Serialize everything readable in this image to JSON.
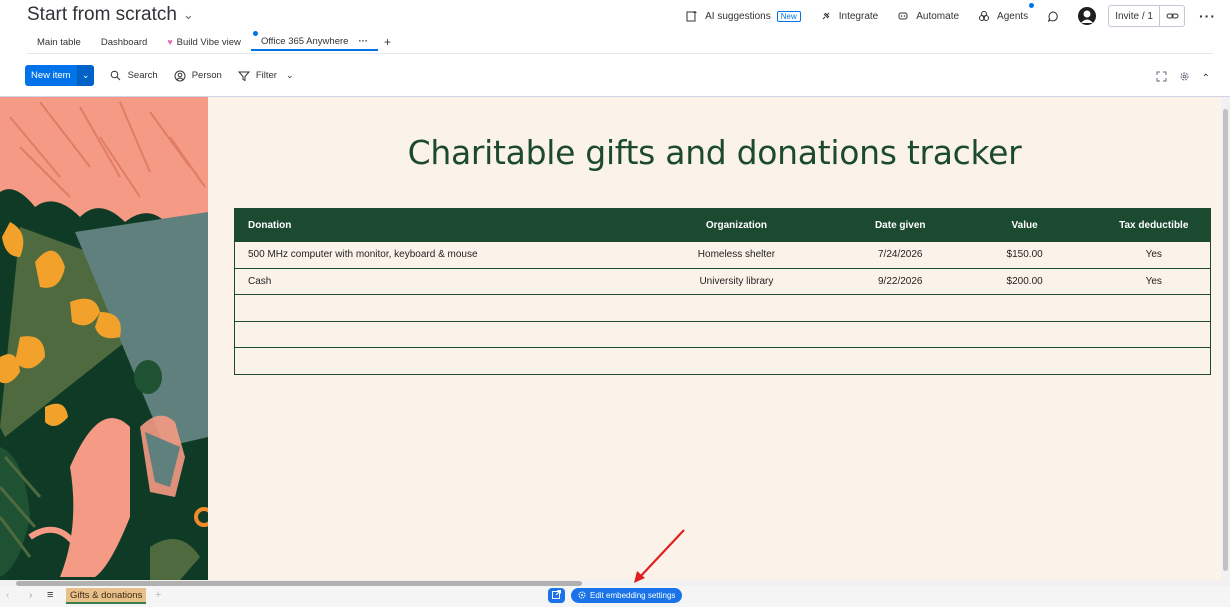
{
  "header": {
    "board_title": "Start from scratch",
    "actions": {
      "ai_suggestions": "AI suggestions",
      "ai_badge": "New",
      "integrate": "Integrate",
      "automate": "Automate",
      "agents": "Agents",
      "invite": "Invite / 1"
    }
  },
  "tabs": [
    {
      "label": "Main table"
    },
    {
      "label": "Dashboard"
    },
    {
      "label": "Build Vibe view"
    },
    {
      "label": "Office 365 Anywhere"
    }
  ],
  "toolbar": {
    "new_item": "New item",
    "search": "Search",
    "person": "Person",
    "filter": "Filter"
  },
  "sheet": {
    "title": "Charitable gifts and donations tracker",
    "columns": [
      "Donation",
      "Organization",
      "Date given",
      "Value",
      "Tax deductible"
    ],
    "rows": [
      [
        "500 MHz computer with monitor, keyboard & mouse",
        "Homeless shelter",
        "7/24/2026",
        "$150.00",
        "Yes"
      ],
      [
        "Cash",
        "University library",
        "9/22/2026",
        "$200.00",
        "Yes"
      ],
      [
        "",
        "",
        "",
        "",
        ""
      ],
      [
        "",
        "",
        "",
        "",
        ""
      ],
      [
        "",
        "",
        "",
        "",
        ""
      ]
    ]
  },
  "bottom": {
    "sheet_tab": "Gifts & donations",
    "embed_settings": "Edit embedding settings"
  },
  "colors": {
    "accent": "#0073ea",
    "sheet_header": "#1c4a31",
    "sheet_bg": "#fbf3e9",
    "sheet_tab": "#e8c08a"
  }
}
